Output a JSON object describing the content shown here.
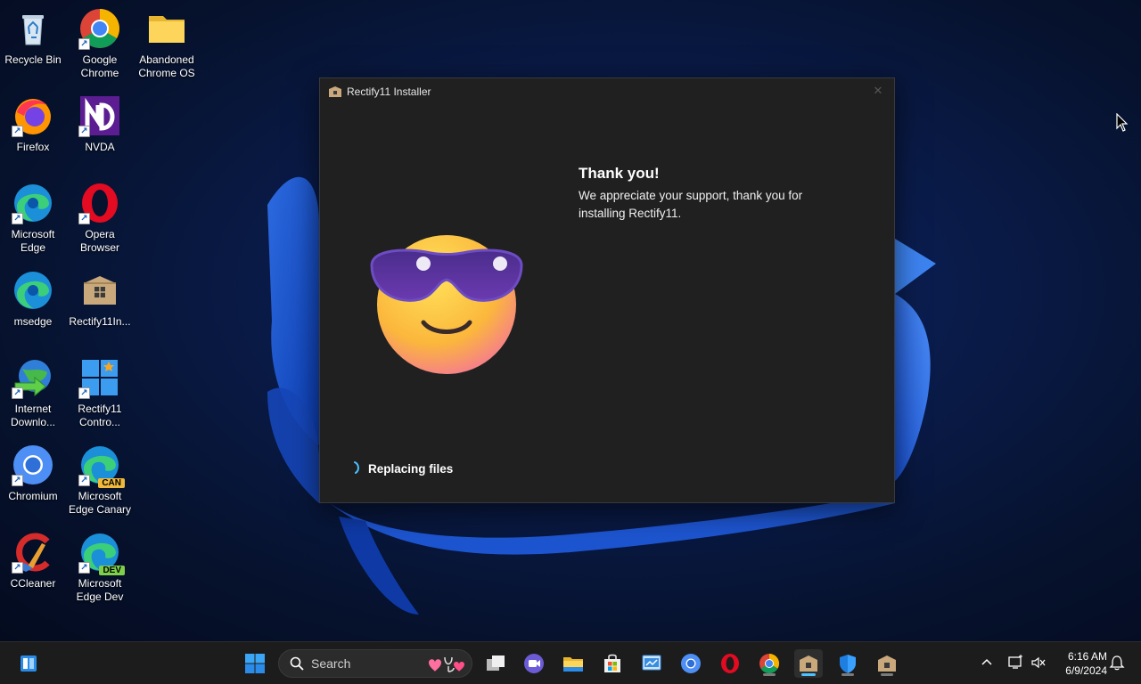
{
  "desktop": {
    "icons": [
      {
        "label": "Recycle Bin",
        "icon": "recycle-bin-icon"
      },
      {
        "label": "Google\nChrome",
        "icon": "chrome-icon"
      },
      {
        "label": "Abandoned\nChrome OS",
        "icon": "folder-icon"
      },
      {
        "label": "Firefox",
        "icon": "firefox-icon"
      },
      {
        "label": "NVDA",
        "icon": "nvda-icon"
      },
      {
        "label": "Microsoft\nEdge",
        "icon": "edge-icon"
      },
      {
        "label": "Opera\nBrowser",
        "icon": "opera-icon"
      },
      {
        "label": "msedge",
        "icon": "edge-icon"
      },
      {
        "label": "Rectify11In...",
        "icon": "package-icon"
      },
      {
        "label": "Internet\nDownlo...",
        "icon": "internet-download-manager-icon"
      },
      {
        "label": "Rectify11\nContro...",
        "icon": "windows-tiles-icon"
      },
      {
        "label": "Chromium",
        "icon": "chromium-icon"
      },
      {
        "label": "Microsoft\nEdge Canary",
        "icon": "edge-canary-icon",
        "badge": "CAN"
      },
      {
        "label": "CCleaner",
        "icon": "ccleaner-icon"
      },
      {
        "label": "Microsoft\nEdge Dev",
        "icon": "edge-dev-icon",
        "badge": "DEV"
      }
    ]
  },
  "installer": {
    "title": "Rectify11 Installer",
    "close_glyph": "✕",
    "heading": "Thank you!",
    "message": "We appreciate your support, thank you for installing Rectify11.",
    "status": "Replacing files"
  },
  "taskbar": {
    "search_placeholder": "Search",
    "clock_time": "6:16 AM",
    "clock_date": "6/9/2024",
    "apps": [
      "start-icon",
      "search-icon",
      "task-view-icon",
      "meet-icon",
      "file-explorer-icon",
      "microsoft-store-icon",
      "control-panel-icon",
      "chromium-icon",
      "opera-icon",
      "chrome-icon",
      "rectify11-installer-icon",
      "defender-icon",
      "package-icon"
    ]
  },
  "colors": {
    "accent": "#4cc2ff",
    "window_bg": "#202020",
    "taskbar_bg": "#1c1c1c"
  }
}
